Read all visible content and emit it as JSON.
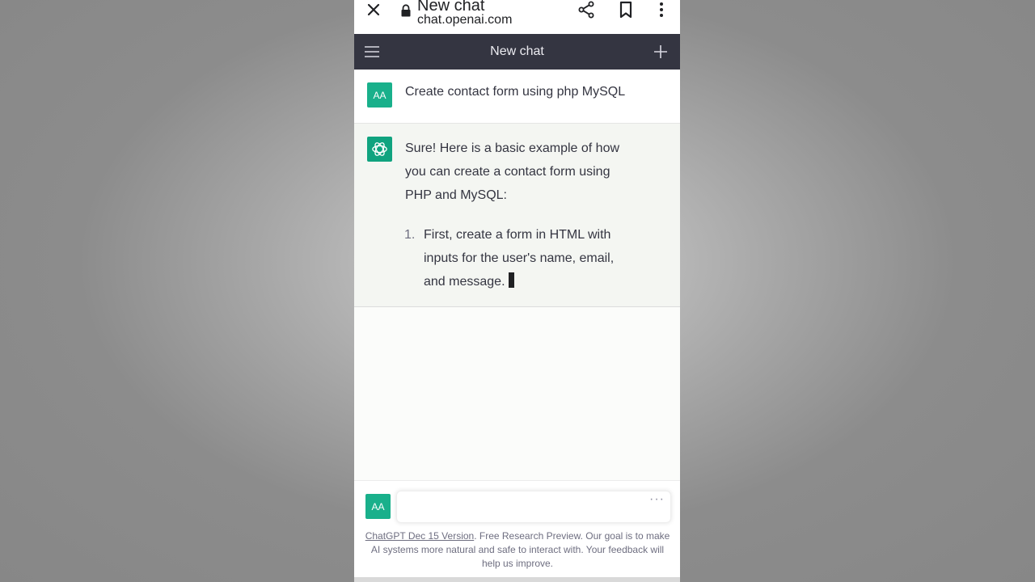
{
  "browser": {
    "page_title": "New chat",
    "domain": "chat.openai.com"
  },
  "header": {
    "title": "New chat"
  },
  "conversation": {
    "user": {
      "avatar_initials": "AA",
      "text": "Create contact form using php MySQL"
    },
    "assistant": {
      "intro": "Sure! Here is a basic example of how you can create a contact form using PHP and MySQL:",
      "list": [
        {
          "number": "1.",
          "text": "First, create a form in HTML with inputs for the user's name, email, and message."
        }
      ]
    }
  },
  "composer": {
    "avatar_initials": "AA",
    "loading_indicator": "···"
  },
  "footer": {
    "link_text": "ChatGPT Dec 15 Version",
    "note": ". Free Research Preview. Our goal is to make AI systems more natural and safe to interact with. Your feedback will help us improve."
  },
  "colors": {
    "header_bg": "#343541",
    "avatar_green": "#19b08b",
    "gpt_green": "#10a37f",
    "assistant_bg": "#f4f6f2"
  },
  "icons": {
    "browser": [
      "close-icon",
      "lock-icon",
      "share-icon",
      "bookmark-icon",
      "more-vert-icon"
    ],
    "header": [
      "hamburger-menu-icon",
      "plus-icon"
    ],
    "assistant": [
      "openai-logo-icon"
    ]
  }
}
